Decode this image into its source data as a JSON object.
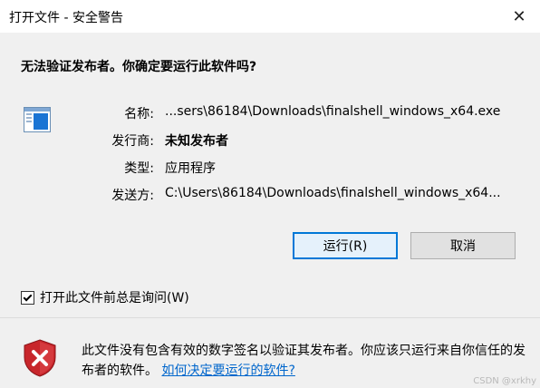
{
  "window": {
    "title": "打开文件 - 安全警告",
    "close_glyph": "✕"
  },
  "headline": "无法验证发布者。你确定要运行此软件吗?",
  "details": {
    "name_label": "名称:",
    "name_value": "...sers\\86184\\Downloads\\finalshell_windows_x64.exe",
    "publisher_label": "发行商:",
    "publisher_value": "未知发布者",
    "type_label": "类型:",
    "type_value": "应用程序",
    "from_label": "发送方:",
    "from_value": "C:\\Users\\86184\\Downloads\\finalshell_windows_x64..."
  },
  "buttons": {
    "run_label": "运行(R)",
    "cancel_label": "取消"
  },
  "checkbox": {
    "label": "打开此文件前总是询问(W)",
    "checked": true
  },
  "footer": {
    "warning_text": "此文件没有包含有效的数字签名以验证其发布者。你应该只运行来自你信任的发布者的软件。",
    "link_text": "如何决定要运行的软件?"
  },
  "watermark": "CSDN @xrkhy",
  "icons": {
    "app": "application-window-icon",
    "shield": "security-shield-error-icon"
  },
  "colors": {
    "accent": "#0078d7",
    "link": "#0066cc",
    "shield_red": "#c8262b"
  }
}
